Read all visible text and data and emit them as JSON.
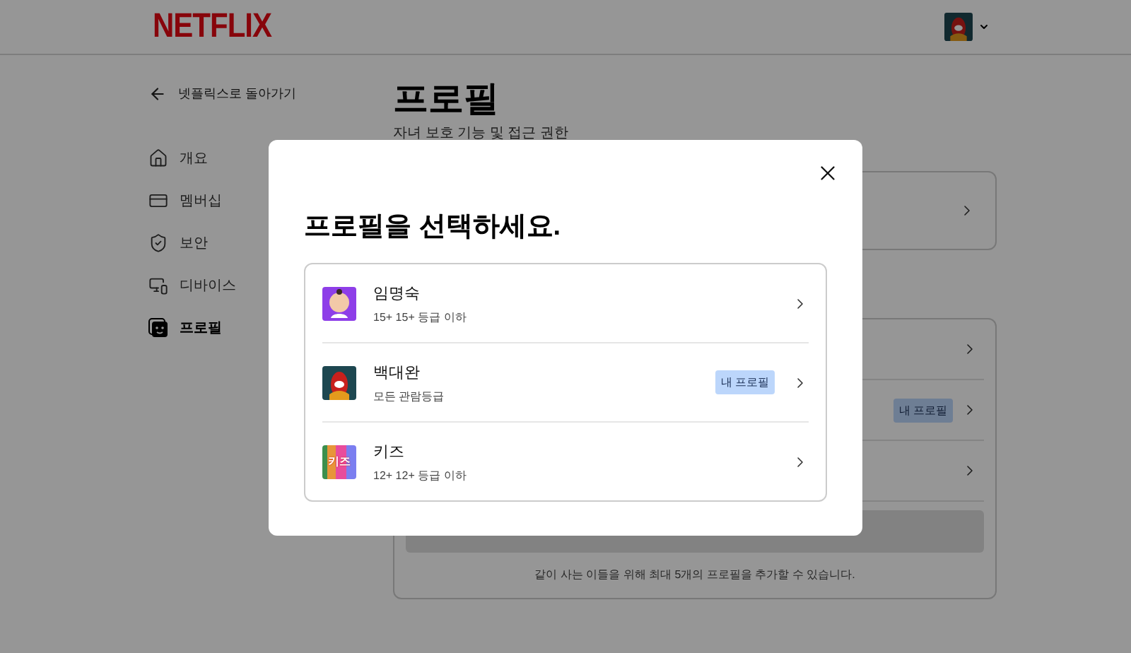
{
  "header": {
    "logo": "NETFLIX"
  },
  "sidebar": {
    "back_link": "넷플릭스로 돌아가기",
    "items": [
      {
        "label": "개요",
        "kind": "home",
        "selected": false
      },
      {
        "label": "멤버십",
        "kind": "card",
        "selected": false
      },
      {
        "label": "보안",
        "kind": "shield",
        "selected": false
      },
      {
        "label": "디바이스",
        "kind": "devices",
        "selected": false
      },
      {
        "label": "프로필",
        "kind": "profile",
        "selected": true
      }
    ]
  },
  "main": {
    "title": "프로필",
    "subtitle": "자녀 보호 기능 및 접근 권한",
    "profile_rows": [
      {},
      {
        "badge": "내 프로필"
      },
      {}
    ],
    "footer_note": "같이 사는 이들을 위해 최대 5개의 프로필을 추가할 수 있습니다."
  },
  "modal": {
    "title": "프로필을 선택하세요.",
    "profiles": [
      {
        "kind": "baby",
        "name": "임명숙",
        "rating": "15+ 15+ 등급 이하"
      },
      {
        "kind": "creature",
        "name": "백대완",
        "rating": "모든 관람등급",
        "badge": "내 프로필"
      },
      {
        "kind": "kids",
        "avatar_text": "키즈",
        "name": "키즈",
        "rating": "12+ 12+ 등급 이하"
      }
    ]
  }
}
